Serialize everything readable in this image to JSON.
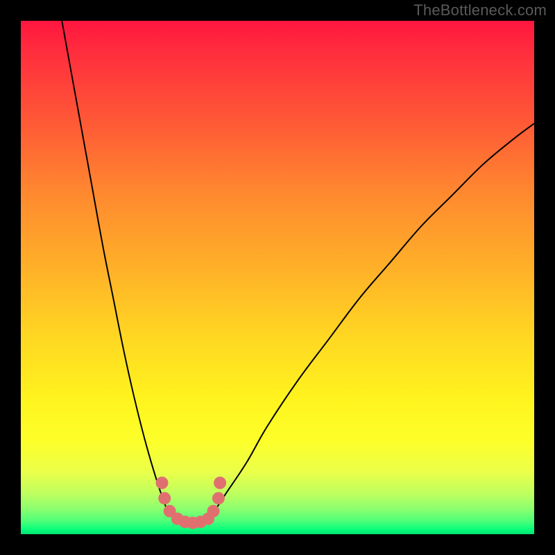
{
  "watermark": "TheBottleneck.com",
  "colors": {
    "frame": "#000000",
    "curve_stroke": "#000000",
    "marker_fill": "#e07070",
    "marker_stroke": "#c85a5a",
    "gradient_top": "#ff163f",
    "gradient_bottom": "#00e474"
  },
  "chart_data": {
    "type": "line",
    "title": "",
    "xlabel": "",
    "ylabel": "",
    "xlim": [
      0,
      100
    ],
    "ylim": [
      0,
      100
    ],
    "series": [
      {
        "name": "left-branch",
        "x": [
          8,
          10,
          12,
          14,
          16,
          18,
          20,
          22,
          24,
          26,
          28,
          29,
          30
        ],
        "y": [
          100,
          89,
          78,
          67,
          56,
          46,
          36,
          27,
          19,
          12,
          6,
          4,
          3
        ]
      },
      {
        "name": "valley-floor",
        "x": [
          30,
          31,
          32,
          33,
          34,
          35,
          36
        ],
        "y": [
          3,
          2.4,
          2.2,
          2.1,
          2.2,
          2.4,
          3
        ]
      },
      {
        "name": "right-branch",
        "x": [
          36,
          38,
          40,
          44,
          48,
          54,
          60,
          66,
          72,
          78,
          84,
          90,
          96,
          100
        ],
        "y": [
          3,
          5,
          8,
          14,
          21,
          30,
          38,
          46,
          53,
          60,
          66,
          72,
          77,
          80
        ]
      }
    ],
    "markers": {
      "name": "valley-markers",
      "x": [
        27.5,
        28,
        29,
        30.5,
        32,
        33.5,
        35,
        36.5,
        37.5,
        38.5,
        38.8
      ],
      "y": [
        10,
        7,
        4.5,
        3,
        2.4,
        2.2,
        2.4,
        3,
        4.5,
        7,
        10
      ]
    }
  }
}
